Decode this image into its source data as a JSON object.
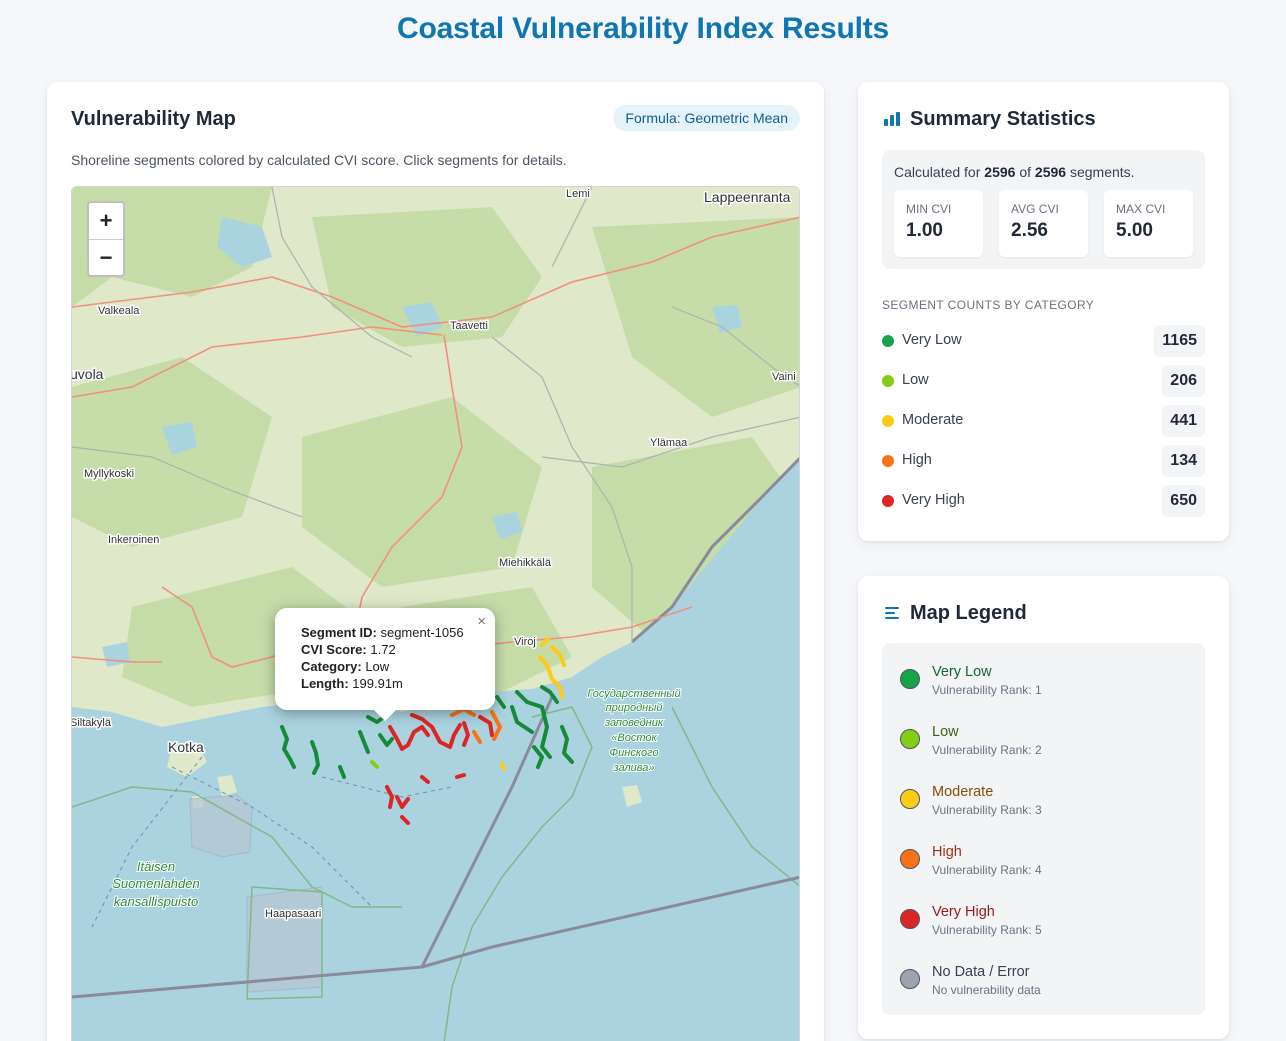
{
  "page": {
    "title": "Coastal Vulnerability Index Results"
  },
  "map_card": {
    "title": "Vulnerability Map",
    "formula_badge": "Formula: Geometric Mean",
    "description": "Shoreline segments colored by calculated CVI score. Click segments for details.",
    "zoom_in": "+",
    "zoom_out": "−",
    "place_labels": {
      "lemi": "Lemi",
      "lappeenranta": "Lappeenranta",
      "valkeala": "Valkeala",
      "taavetti": "Taavetti",
      "kouvola": "uvola",
      "vainikkala": "Vaini",
      "ylamaa": "Ylämaa",
      "myllykoski": "Myllykoski",
      "inkeroinen": "Inkeroinen",
      "miehikkala": "Miehikkälä",
      "virolahti": "Viroj",
      "siltakyla": "Siltakylä",
      "kotka": "Kotka",
      "haapasaari": "Haapasaari",
      "park_line1": "Itäisen",
      "park_line2": "Suomenlahden",
      "park_line3": "kansallispuisto",
      "reserve_line1": "Государственный",
      "reserve_line2": "природный",
      "reserve_line3": "заповедник",
      "reserve_line4": "«Восток",
      "reserve_line5": "Финского",
      "reserve_line6": "залива»"
    },
    "popup": {
      "segment_id_label": "Segment ID:",
      "segment_id": "segment-1056",
      "cvi_label": "CVI Score:",
      "cvi_value": "1.72",
      "category_label": "Category:",
      "category_value": "Low",
      "length_label": "Length:",
      "length_value": "199.91m",
      "close": "×"
    }
  },
  "stats_card": {
    "title": "Summary Statistics",
    "icon": "bar-chart-icon",
    "calculated_prefix": "Calculated for",
    "calculated_count": "2596",
    "calculated_of": "of",
    "calculated_total": "2596",
    "calculated_suffix": "segments.",
    "min_label": "MIN CVI",
    "min_value": "1.00",
    "avg_label": "AVG CVI",
    "avg_value": "2.56",
    "max_label": "MAX CVI",
    "max_value": "5.00",
    "counts_heading": "SEGMENT COUNTS BY CATEGORY",
    "counts": [
      {
        "label": "Very Low",
        "value": "1165",
        "color": "#16a34a"
      },
      {
        "label": "Low",
        "value": "206",
        "color": "#84cc16"
      },
      {
        "label": "Moderate",
        "value": "441",
        "color": "#facc15"
      },
      {
        "label": "High",
        "value": "134",
        "color": "#f97316"
      },
      {
        "label": "Very High",
        "value": "650",
        "color": "#dc2626"
      }
    ]
  },
  "legend_card": {
    "title": "Map Legend",
    "icon": "list-icon",
    "items": [
      {
        "name": "Very Low",
        "rank": "Vulnerability Rank: 1",
        "color": "#16a34a",
        "text_color": "#166534"
      },
      {
        "name": "Low",
        "rank": "Vulnerability Rank: 2",
        "color": "#84cc16",
        "text_color": "#3f6212"
      },
      {
        "name": "Moderate",
        "rank": "Vulnerability Rank: 3",
        "color": "#facc15",
        "text_color": "#854d0e"
      },
      {
        "name": "High",
        "rank": "Vulnerability Rank: 4",
        "color": "#f97316",
        "text_color": "#9a3412"
      },
      {
        "name": "Very High",
        "rank": "Vulnerability Rank: 5",
        "color": "#dc2626",
        "text_color": "#991b1b"
      },
      {
        "name": "No Data / Error",
        "rank": "No vulnerability data",
        "color": "#9ca3af",
        "text_color": "#374151"
      }
    ]
  }
}
